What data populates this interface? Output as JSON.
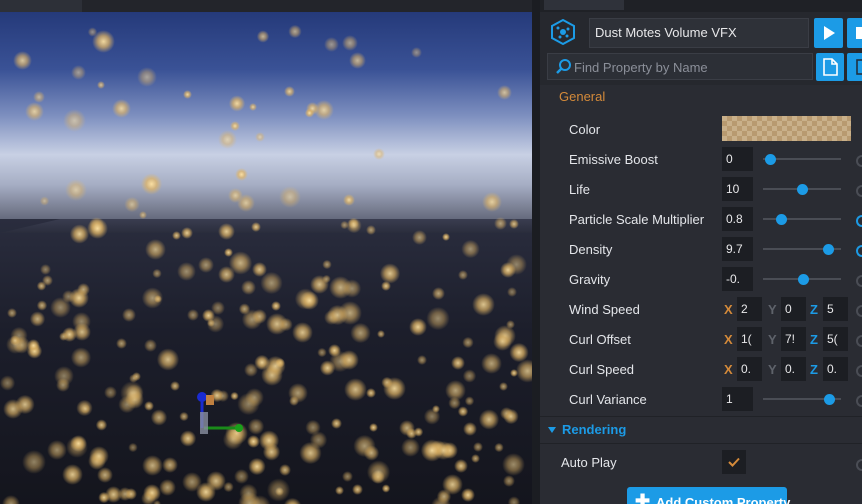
{
  "object": {
    "name": "Dust Motes Volume VFX"
  },
  "search": {
    "placeholder": "Find Property by Name"
  },
  "sections": {
    "general": "General",
    "rendering": "Rendering"
  },
  "properties": [
    {
      "label": "Color",
      "type": "color"
    },
    {
      "label": "Emissive Boost",
      "value": "0",
      "slider": 0.0
    },
    {
      "label": "Life",
      "value": "10",
      "slider": 0.48
    },
    {
      "label": "Particle Scale Multiplier",
      "value": "0.8",
      "slider": 0.16
    },
    {
      "label": "Density",
      "value": "9.7",
      "slider": 0.88
    },
    {
      "label": "Gravity",
      "value": "-0.",
      "slider": 0.5
    },
    {
      "label": "Wind Speed",
      "x": "2",
      "y": "0",
      "z": "5"
    },
    {
      "label": "Curl Offset",
      "x": "1(",
      "y": "7!",
      "z": "5("
    },
    {
      "label": "Curl Speed",
      "x": "0.",
      "y": "0.",
      "z": "0."
    },
    {
      "label": "Curl Variance",
      "value": "1",
      "slider": 0.9
    }
  ],
  "axis_labels": {
    "x": "X",
    "y": "Y",
    "z": "Z"
  },
  "rendering": {
    "auto_play_label": "Auto Play",
    "auto_play_checked": true
  },
  "buttons": {
    "add_custom_property": "Add Custom Property"
  },
  "colors": {
    "accent": "#1c9be6",
    "section_general": "#d48a3a",
    "panel_bg": "#2a2c33"
  }
}
